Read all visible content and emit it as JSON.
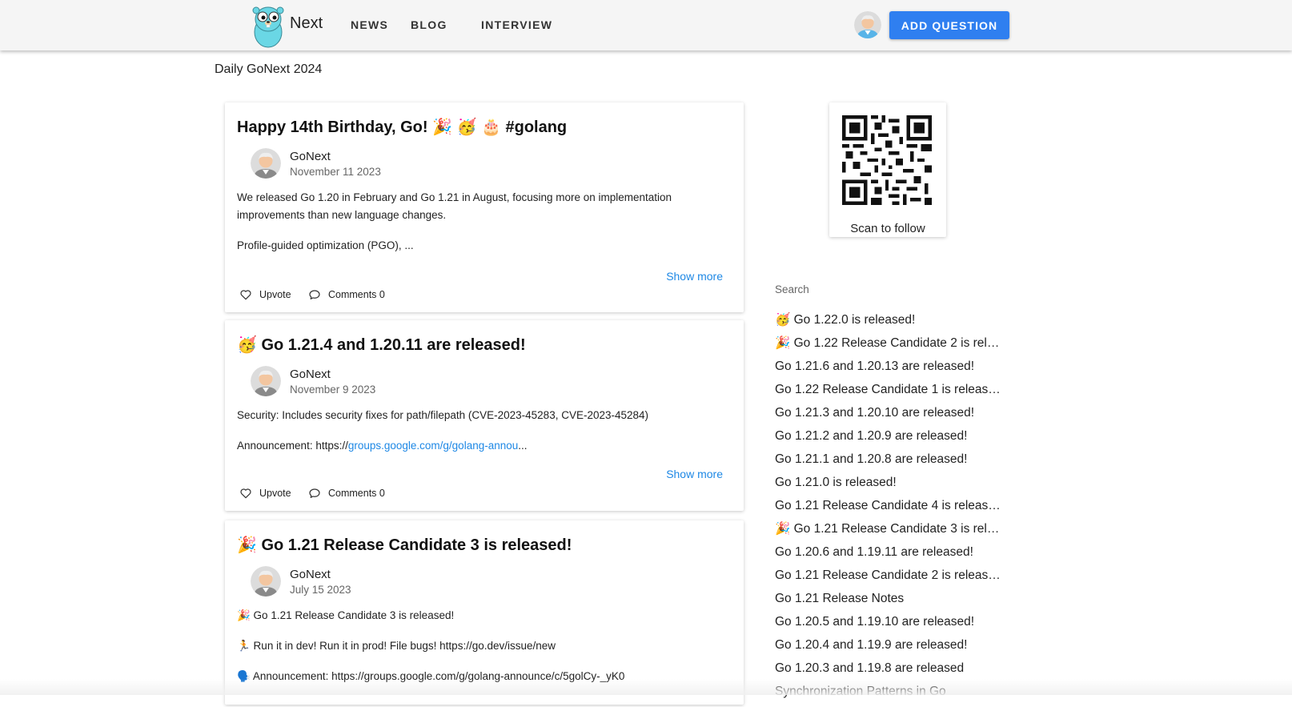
{
  "header": {
    "brand": "Next",
    "nav": [
      "NEWS",
      "BLOG",
      "INTERVIEW"
    ],
    "add_button": "ADD QUESTION"
  },
  "page_title": "Daily GoNext 2024",
  "posts": [
    {
      "title": "Happy 14th Birthday, Go! 🎉 🥳 🎂 #golang",
      "author": "GoNext",
      "date": "November 11 2023",
      "para1": "We released Go 1.20 in February and Go 1.21 in August, focusing more on implementation improvements than new language changes.",
      "para2": "Profile-guided optimization (PGO), ...",
      "show_more": "Show more",
      "upvote": "Upvote",
      "comments": "Comments 0"
    },
    {
      "title": "🥳 Go 1.21.4 and 1.20.11 are released!",
      "author": "GoNext",
      "date": "November 9 2023",
      "para1": "Security: Includes security fixes for path/filepath (CVE-2023-45283, CVE-2023-45284)",
      "para2_prefix": "Announcement: https://",
      "para2_link": "groups.google.com/g/golang-annou",
      "para2_suffix": "...",
      "show_more": "Show more",
      "upvote": "Upvote",
      "comments": "Comments 0"
    },
    {
      "title": "🎉 Go 1.21 Release Candidate 3 is released!",
      "author": "GoNext",
      "date": "July 15 2023",
      "para1": "🎉 Go 1.21 Release Candidate 3 is released!",
      "para2": "🏃 Run it in dev! Run it in prod! File bugs! https://go.dev/issue/new",
      "para3": "🗣️ Announcement: https://groups.google.com/g/golang-announce/c/5golCy-_yK0"
    }
  ],
  "sidebar": {
    "qr_caption": "Scan to follow",
    "search_label": "Search",
    "items": [
      "🥳 Go 1.22.0 is released!",
      "🎉 Go 1.22 Release Candidate 2 is rel…",
      "Go 1.21.6 and 1.20.13 are released!",
      "Go 1.22 Release Candidate 1 is releas…",
      "Go 1.21.3 and 1.20.10 are released!",
      "Go 1.21.2 and 1.20.9 are released!",
      "Go 1.21.1 and 1.20.8 are released!",
      "Go 1.21.0 is released!",
      "Go 1.21 Release Candidate 4 is releas…",
      "🎉 Go 1.21 Release Candidate 3 is rel…",
      "Go 1.20.6 and 1.19.11 are released!",
      "Go 1.21 Release Candidate 2 is releas…",
      "Go 1.21 Release Notes",
      "Go 1.20.5 and 1.19.10 are released!",
      "Go 1.20.4 and 1.19.9 are released!",
      "Go 1.20.3 and 1.19.8 are released",
      "Synchronization Patterns in Go"
    ]
  },
  "icons": {
    "logo": "gopher-icon",
    "avatar": "user-avatar-icon",
    "upvote": "heart-icon",
    "comments": "comment-icon",
    "qr": "qr-code"
  },
  "colors": {
    "accent": "#2f7ff0",
    "link": "#1e88e5",
    "appbar": "#f5f5f5"
  }
}
